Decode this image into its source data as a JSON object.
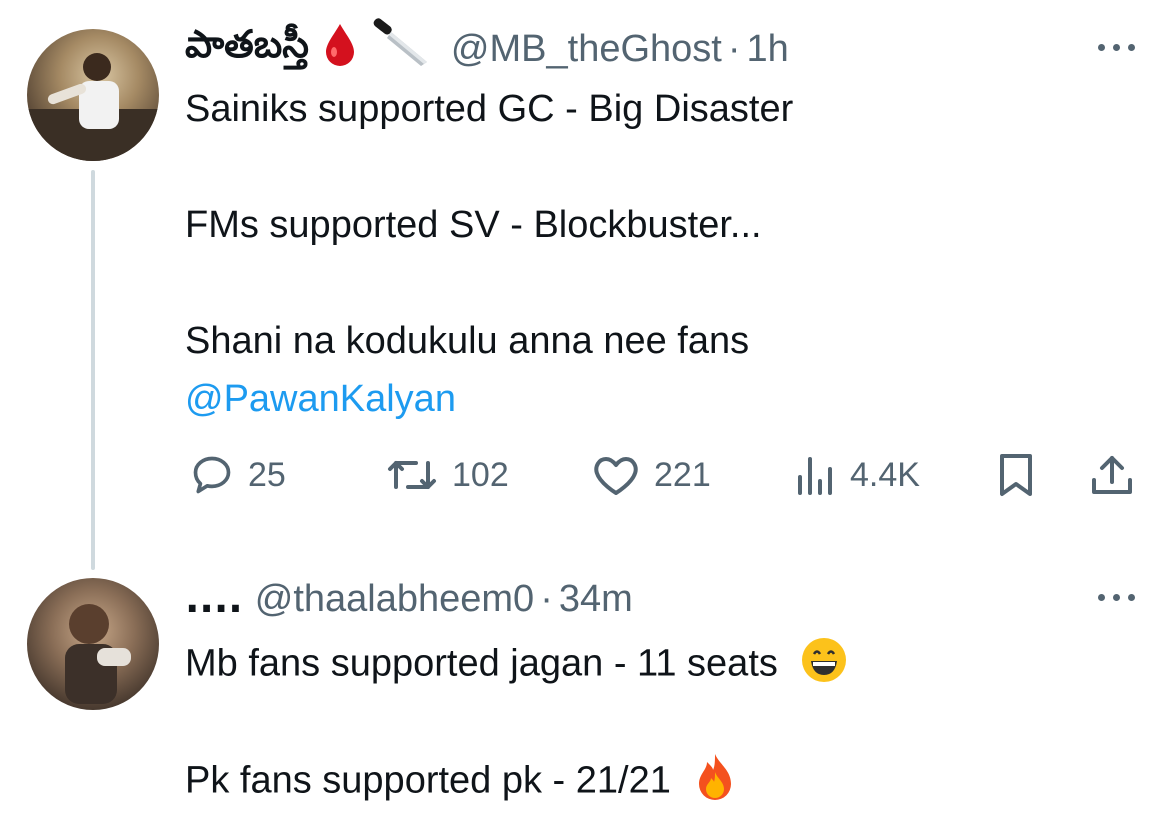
{
  "tweet": {
    "author_name": "పాతబస్తీ",
    "handle": "@MB_theGhost",
    "separator": "·",
    "time": "1h",
    "lines": [
      "Sainiks supported GC - Big Disaster",
      "FMs supported SV - Blockbuster...",
      "Shani na kodukulu anna nee fans"
    ],
    "mention": "@PawanKalyan",
    "icons": [
      "blood-drop-icon",
      "knife-icon"
    ],
    "actions": {
      "replies": "25",
      "retweets": "102",
      "likes": "221",
      "views": "4.4K"
    }
  },
  "reply": {
    "author_name": "....",
    "handle": "@thaalabheem0",
    "separator": "·",
    "time": "34m",
    "lines": [
      "Mb fans supported jagan - 11 seats",
      "Pk fans supported pk - 21/21"
    ],
    "icons": [
      "grin-emoji-icon",
      "fire-emoji-icon"
    ]
  },
  "colors": {
    "text": "#0f1419",
    "secondary": "#536471",
    "link": "#1d9bf0",
    "thread_line": "#cfd9de",
    "background": "#ffffff"
  }
}
